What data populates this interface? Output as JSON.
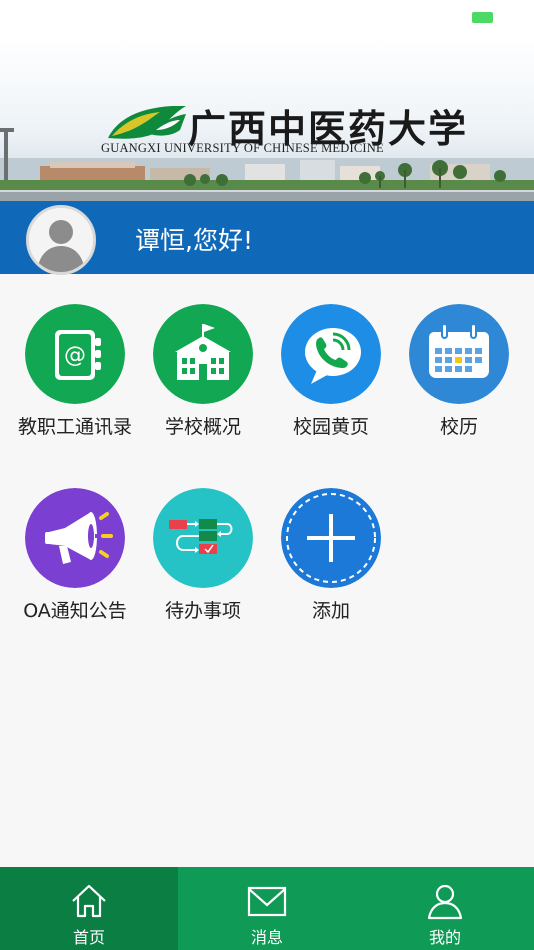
{
  "banner": {
    "name_cn": "广西中医药大学",
    "name_en": "GUANGXI UNIVERSITY OF CHINESE MEDICINE"
  },
  "user": {
    "greeting": "谭恒,您好!"
  },
  "apps": [
    {
      "label": "教职工通讯录",
      "icon": "address-book-icon",
      "color": "#12a853"
    },
    {
      "label": "学校概况",
      "icon": "school-building-icon",
      "color": "#12a853"
    },
    {
      "label": "校园黄页",
      "icon": "phone-chat-icon",
      "color": "#1e8de6"
    },
    {
      "label": "校历",
      "icon": "calendar-icon",
      "color": "#2f88d6"
    },
    {
      "label": "OA通知公告",
      "icon": "megaphone-icon",
      "color": "#7b3fd1"
    },
    {
      "label": "待办事项",
      "icon": "workflow-icon",
      "color": "#26c3c6"
    },
    {
      "label": "添加",
      "icon": "plus-icon",
      "color": "#1d79d8"
    }
  ],
  "tabs": [
    {
      "label": "首页",
      "icon": "home-icon",
      "active": true
    },
    {
      "label": "消息",
      "icon": "envelope-icon",
      "active": false
    },
    {
      "label": "我的",
      "icon": "user-icon",
      "active": false
    }
  ],
  "colors": {
    "header_blue": "#0f68b8",
    "tabbar_green": "#0f9a55",
    "tabbar_active": "#0a7e43"
  }
}
